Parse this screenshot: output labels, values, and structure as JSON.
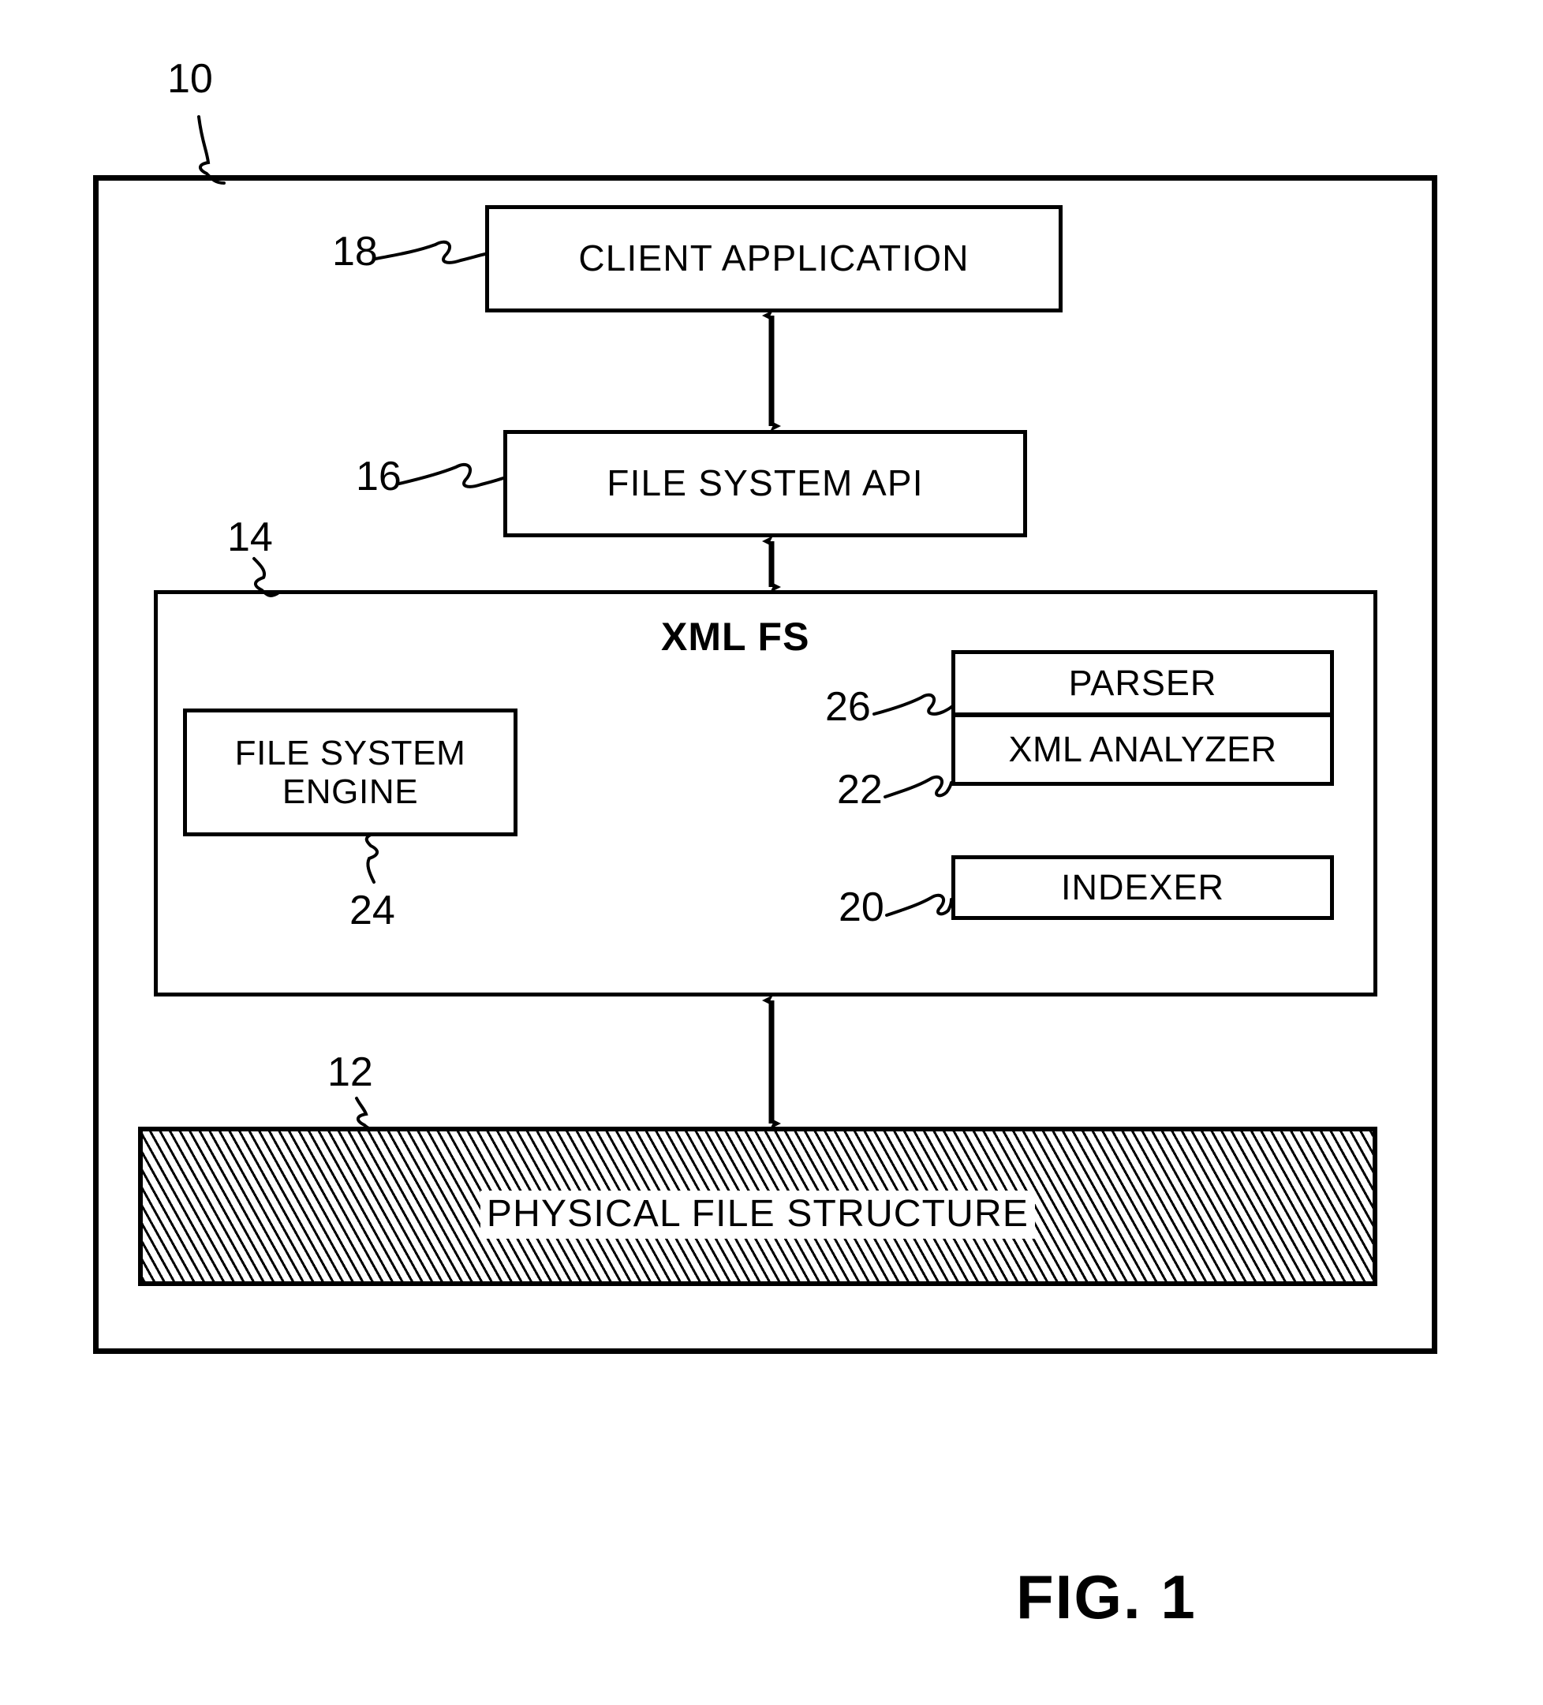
{
  "figure": {
    "caption": "FIG. 1",
    "system_label": "10"
  },
  "blocks": {
    "client_application": {
      "label": "CLIENT APPLICATION",
      "ref": "18"
    },
    "file_system_api": {
      "label": "FILE SYSTEM API",
      "ref": "16"
    },
    "xml_fs": {
      "label": "XML FS",
      "ref": "14"
    },
    "file_system_engine": {
      "label": "FILE SYSTEM\nENGINE",
      "line1": "FILE SYSTEM",
      "line2": "ENGINE",
      "ref": "24"
    },
    "parser": {
      "label": "PARSER",
      "ref": "26"
    },
    "xml_analyzer": {
      "label": "XML ANALYZER",
      "ref": "22"
    },
    "indexer": {
      "label": "INDEXER",
      "ref": "20"
    },
    "physical_file_structure": {
      "label": "PHYSICAL FILE STRUCTURE",
      "ref": "12"
    }
  },
  "connectors": [
    {
      "name": "client-app-to-file-system-api",
      "type": "double-arrow-vertical"
    },
    {
      "name": "file-system-api-to-xml-fs",
      "type": "double-arrow-vertical"
    },
    {
      "name": "xml-fs-to-physical-file-structure",
      "type": "double-arrow-vertical"
    }
  ],
  "colors": {
    "ink": "#000000",
    "paper": "#ffffff"
  }
}
